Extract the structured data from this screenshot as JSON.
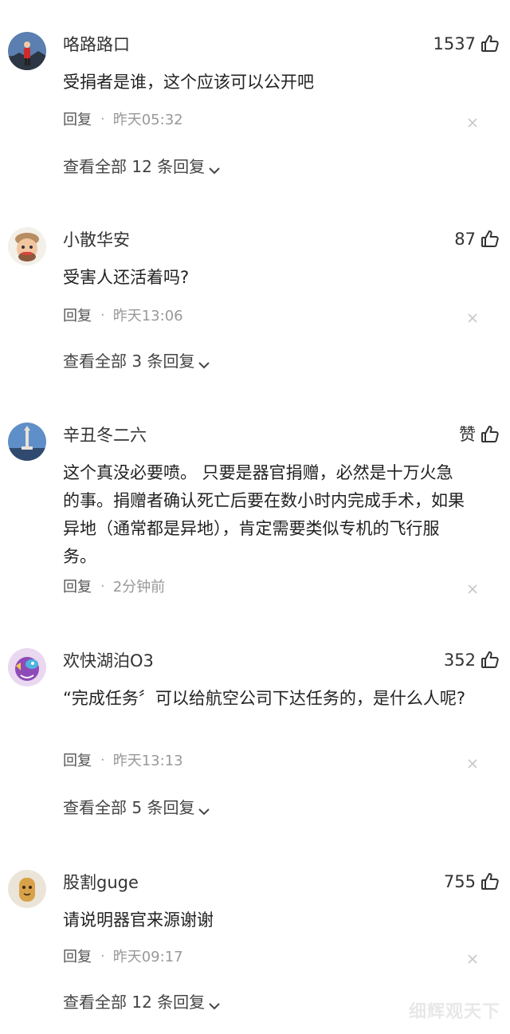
{
  "reply_label": "回复",
  "comments": [
    {
      "username": "咯路路口",
      "likes": "1537",
      "text": "受捐者是谁，这个应该可以公开吧",
      "time": "昨天05:32",
      "more_replies": "查看全部 12 条回复"
    },
    {
      "username": "小散华安",
      "likes": "87",
      "text": "受害人还活着吗?",
      "time": "昨天13:06",
      "more_replies": "查看全部 3 条回复"
    },
    {
      "username": "辛丑冬二六",
      "likes": "赞",
      "text": "这个真没必要喷。 只要是器官捐赠，必然是十万火急的事。捐赠者确认死亡后要在数小时内完成手术，如果异地（通常都是异地），肯定需要类似专机的飞行服务。",
      "time": "2分钟前",
      "more_replies": ""
    },
    {
      "username": "欢快湖泊O3",
      "likes": "352",
      "text": "“完成任务〞可以给航空公司下达任务的，是什么人呢?",
      "time": "昨天13:13",
      "more_replies": "查看全部 5 条回复"
    },
    {
      "username": "股割guge",
      "likes": "755",
      "text": "请说明器官来源谢谢",
      "time": "昨天09:17",
      "more_replies": "查看全部 12 条回复"
    }
  ],
  "watermark": "细辉观天下",
  "icons": {
    "like": "thumbs-up-icon",
    "close": "close-icon",
    "chevron": "chevron-down-icon"
  }
}
